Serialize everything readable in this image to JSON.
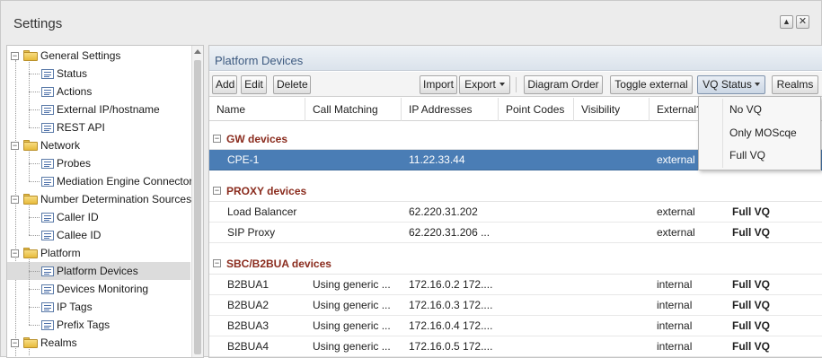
{
  "window": {
    "title": "Settings",
    "collapse_glyph": "▲",
    "close_glyph": "✕"
  },
  "tree": {
    "items": [
      {
        "label": "General Settings",
        "type": "folder",
        "expanded": true
      },
      {
        "label": "Status",
        "type": "leaf"
      },
      {
        "label": "Actions",
        "type": "leaf"
      },
      {
        "label": "External IP/hostname",
        "type": "leaf"
      },
      {
        "label": "REST API",
        "type": "leaf"
      },
      {
        "label": "Network",
        "type": "folder",
        "expanded": true
      },
      {
        "label": "Probes",
        "type": "leaf"
      },
      {
        "label": "Mediation Engine Connectors",
        "type": "leaf"
      },
      {
        "label": "Number Determination Sources",
        "type": "folder",
        "expanded": true
      },
      {
        "label": "Caller ID",
        "type": "leaf"
      },
      {
        "label": "Callee ID",
        "type": "leaf"
      },
      {
        "label": "Platform",
        "type": "folder",
        "expanded": true
      },
      {
        "label": "Platform Devices",
        "type": "leaf",
        "selected": true
      },
      {
        "label": "Devices Monitoring",
        "type": "leaf"
      },
      {
        "label": "IP Tags",
        "type": "leaf"
      },
      {
        "label": "Prefix Tags",
        "type": "leaf"
      },
      {
        "label": "Realms",
        "type": "folder",
        "expanded": true
      }
    ],
    "expander_minus": "−"
  },
  "panel": {
    "title": "Platform Devices",
    "toolbar": {
      "add": "Add",
      "edit": "Edit",
      "delete": "Delete",
      "import": "Import",
      "export": "Export",
      "diagram_order": "Diagram Order",
      "toggle_external": "Toggle external",
      "vq_status": "VQ Status",
      "realms": "Realms"
    },
    "columns": [
      "Name",
      "Call Matching",
      "IP Addresses",
      "Point Codes",
      "Visibility",
      "External?"
    ],
    "groups": [
      {
        "label": "GW devices",
        "rows": [
          {
            "name": "CPE-1",
            "call_matching": "",
            "ip": "11.22.33.44",
            "point_codes": "",
            "visibility": "",
            "external": "external",
            "vq": "",
            "selected": true
          }
        ]
      },
      {
        "label": "PROXY devices",
        "rows": [
          {
            "name": "Load Balancer",
            "call_matching": "",
            "ip": "62.220.31.202",
            "point_codes": "",
            "visibility": "",
            "external": "external",
            "vq": "Full VQ"
          },
          {
            "name": "SIP Proxy",
            "call_matching": "",
            "ip": "62.220.31.206 ...",
            "point_codes": "",
            "visibility": "",
            "external": "external",
            "vq": "Full VQ"
          }
        ]
      },
      {
        "label": "SBC/B2BUA devices",
        "rows": [
          {
            "name": "B2BUA1",
            "call_matching": "Using generic ...",
            "ip": "172.16.0.2 172....",
            "point_codes": "",
            "visibility": "",
            "external": "internal",
            "vq": "Full VQ"
          },
          {
            "name": "B2BUA2",
            "call_matching": "Using generic ...",
            "ip": "172.16.0.3 172....",
            "point_codes": "",
            "visibility": "",
            "external": "internal",
            "vq": "Full VQ"
          },
          {
            "name": "B2BUA3",
            "call_matching": "Using generic ...",
            "ip": "172.16.0.4 172....",
            "point_codes": "",
            "visibility": "",
            "external": "internal",
            "vq": "Full VQ"
          },
          {
            "name": "B2BUA4",
            "call_matching": "Using generic ...",
            "ip": "172.16.0.5 172....",
            "point_codes": "",
            "visibility": "",
            "external": "internal",
            "vq": "Full VQ"
          }
        ]
      }
    ],
    "group_toggle": "−"
  },
  "vq_menu": {
    "items": [
      "No VQ",
      "Only MOScqe",
      "Full VQ"
    ]
  },
  "colors": {
    "selected_row": "#4a7db5",
    "group_label": "#8a2b1d",
    "panel_title": "#3d5a80"
  }
}
